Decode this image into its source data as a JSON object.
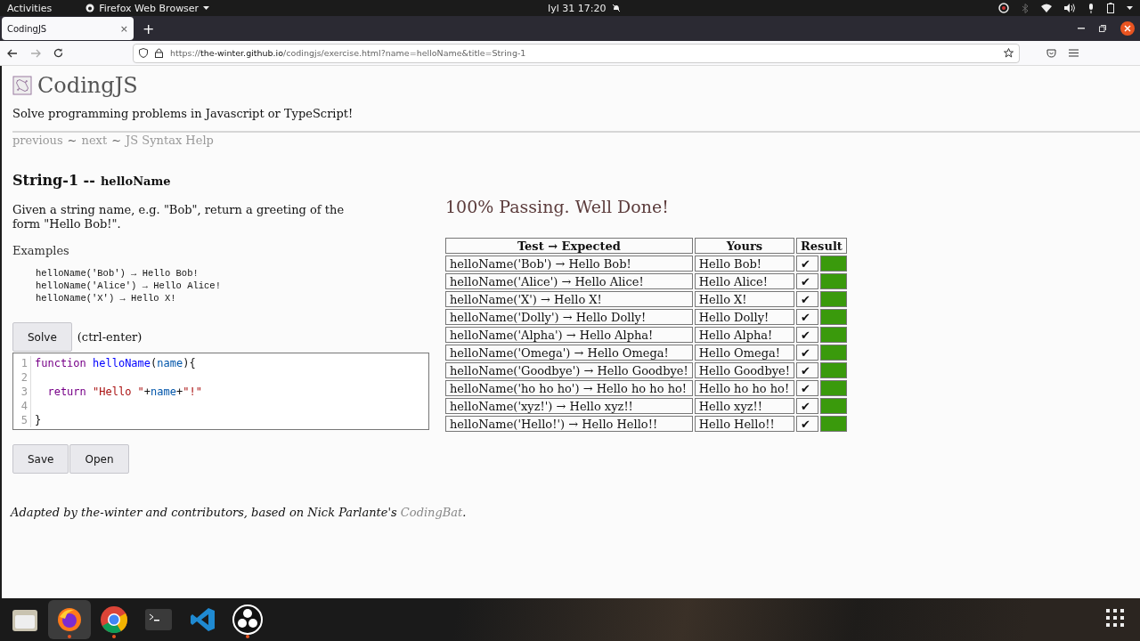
{
  "top_bar": {
    "activities": "Activities",
    "app_menu": "Firefox Web Browser",
    "clock": "Iyl 31  17:20"
  },
  "browser": {
    "tabs": [
      {
        "title": "CodingJS",
        "close": "×",
        "selected": true
      }
    ],
    "new_tab": "+",
    "url": {
      "scheme": "https://",
      "host": "the-winter.github.io",
      "path": "/codingjs/exercise.html?name=helloName&title=String-1"
    }
  },
  "page": {
    "site_title": "CodingJS",
    "tagline": "Solve programming problems in Javascript or TypeScript!",
    "nav": [
      {
        "kind": "link",
        "text": "previous"
      },
      {
        "kind": "sep",
        "text": "~"
      },
      {
        "kind": "link",
        "text": "next"
      },
      {
        "kind": "sep",
        "text": "~"
      },
      {
        "kind": "link",
        "text": "JS Syntax Help"
      }
    ],
    "problem_title": "String-1 --",
    "problem_name": "helloName",
    "description": "Given a string name, e.g. \"Bob\", return a greeting of the form \"Hello Bob!\".",
    "examples_heading": "Examples",
    "examples": [
      "helloName('Bob') → Hello Bob!",
      "helloName('Alice') → Hello Alice!",
      "helloName('X') → Hello X!"
    ],
    "solve_button": "Solve",
    "solve_hint": "(ctrl-enter)",
    "code": [
      {
        "number": "1",
        "tokens": [
          {
            "kind": "keyword",
            "text": "function"
          },
          {
            "kind": "def",
            "text": " helloName"
          },
          {
            "kind": "plain",
            "text": "("
          },
          {
            "kind": "variable",
            "text": "name"
          },
          {
            "kind": "plain",
            "text": "){"
          }
        ]
      },
      {
        "number": "2"
      },
      {
        "number": "3",
        "tokens": [
          {
            "kind": "keyword",
            "text": "  return"
          },
          {
            "kind": "string",
            "text": " \"Hello \""
          },
          {
            "kind": "plain",
            "text": "+"
          },
          {
            "kind": "variable",
            "text": "name"
          },
          {
            "kind": "plain",
            "text": "+"
          },
          {
            "kind": "string",
            "text": "\"!\""
          }
        ]
      },
      {
        "number": "4"
      },
      {
        "number": "5",
        "tokens": [
          {
            "kind": "plain",
            "text": "}"
          }
        ]
      }
    ],
    "buttons": [
      "Save",
      "Open"
    ],
    "result_heading": "100% Passing. Well Done!",
    "table": {
      "columns": [
        "Test → Expected",
        "Yours",
        "Result"
      ],
      "rows": [
        {
          "test": "helloName('Bob') → Hello Bob!",
          "yours": "Hello Bob!",
          "mark": "✔",
          "passed": true
        },
        {
          "test": "helloName('Alice') → Hello Alice!",
          "yours": "Hello Alice!",
          "mark": "✔",
          "passed": true
        },
        {
          "test": "helloName('X') → Hello X!",
          "yours": "Hello X!",
          "mark": "✔",
          "passed": true
        },
        {
          "test": "helloName('Dolly') → Hello Dolly!",
          "yours": "Hello Dolly!",
          "mark": "✔",
          "passed": true
        },
        {
          "test": "helloName('Alpha') → Hello Alpha!",
          "yours": "Hello Alpha!",
          "mark": "✔",
          "passed": true
        },
        {
          "test": "helloName('Omega') → Hello Omega!",
          "yours": "Hello Omega!",
          "mark": "✔",
          "passed": true
        },
        {
          "test": "helloName('Goodbye') → Hello Goodbye!",
          "yours": "Hello Goodbye!",
          "mark": "✔",
          "passed": true
        },
        {
          "test": "helloName('ho ho ho') → Hello ho ho ho!",
          "yours": "Hello ho ho ho!",
          "mark": "✔",
          "passed": true
        },
        {
          "test": "helloName('xyz!') → Hello xyz!!",
          "yours": "Hello xyz!!",
          "mark": "✔",
          "passed": true
        },
        {
          "test": "helloName('Hello!') → Hello Hello!!",
          "yours": "Hello Hello!!",
          "mark": "✔",
          "passed": true
        }
      ]
    },
    "footer": {
      "before": "Adapted by the-winter and contributors, based on Nick Parlante's ",
      "link": "CodingBat",
      "after": "."
    }
  },
  "dock": [
    {
      "kind": "files",
      "running": false,
      "selected": false
    },
    {
      "kind": "firefox",
      "running": true,
      "selected": true
    },
    {
      "kind": "chrome",
      "running": true,
      "selected": false
    },
    {
      "kind": "terminal",
      "running": false,
      "selected": false
    },
    {
      "kind": "vscode",
      "running": false,
      "selected": false
    },
    {
      "kind": "obs",
      "running": true,
      "selected": false
    }
  ]
}
